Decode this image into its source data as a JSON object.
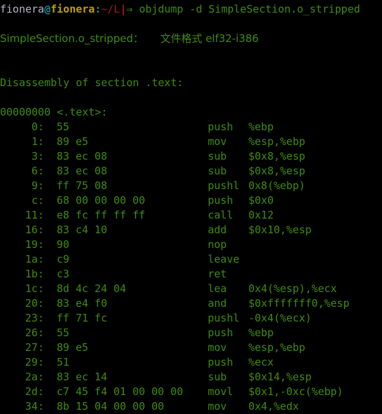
{
  "terminal": {
    "background_color": "#000000",
    "foreground_color": "#3f8c0b",
    "prompt": {
      "user": "fionera",
      "at": "@",
      "host": "fionera",
      "colon": ":",
      "path": "~/L",
      "cursor": "|",
      "arrow": "⇒",
      "command": "objdump -d SimpleSection.o_stripped",
      "user_color": "#b6b6c8",
      "at_color": "#118f94",
      "host_color": "#c0a000",
      "path_color": "#9e1b1b",
      "cursor_color": "#e01b1b",
      "arrow_color": "#4aa013"
    },
    "file_header": "SimpleSection.o_stripped：     文件格式 elf32-i386",
    "section_header": "Disassembly of section .text:",
    "symbol_line": "00000000 <.text>:",
    "disassembly": [
      {
        "addr": "0:",
        "bytes": "55",
        "mnemonic": "push",
        "operands": "%ebp"
      },
      {
        "addr": "1:",
        "bytes": "89 e5",
        "mnemonic": "mov",
        "operands": "%esp,%ebp"
      },
      {
        "addr": "3:",
        "bytes": "83 ec 08",
        "mnemonic": "sub",
        "operands": "$0x8,%esp"
      },
      {
        "addr": "6:",
        "bytes": "83 ec 08",
        "mnemonic": "sub",
        "operands": "$0x8,%esp"
      },
      {
        "addr": "9:",
        "bytes": "ff 75 08",
        "mnemonic": "pushl",
        "operands": "0x8(%ebp)"
      },
      {
        "addr": "c:",
        "bytes": "68 00 00 00 00",
        "mnemonic": "push",
        "operands": "$0x0"
      },
      {
        "addr": "11:",
        "bytes": "e8 fc ff ff ff",
        "mnemonic": "call",
        "operands": "0x12"
      },
      {
        "addr": "16:",
        "bytes": "83 c4 10",
        "mnemonic": "add",
        "operands": "$0x10,%esp"
      },
      {
        "addr": "19:",
        "bytes": "90",
        "mnemonic": "nop",
        "operands": ""
      },
      {
        "addr": "1a:",
        "bytes": "c9",
        "mnemonic": "leave",
        "operands": ""
      },
      {
        "addr": "1b:",
        "bytes": "c3",
        "mnemonic": "ret",
        "operands": ""
      },
      {
        "addr": "1c:",
        "bytes": "8d 4c 24 04",
        "mnemonic": "lea",
        "operands": "0x4(%esp),%ecx"
      },
      {
        "addr": "20:",
        "bytes": "83 e4 f0",
        "mnemonic": "and",
        "operands": "$0xfffffff0,%esp"
      },
      {
        "addr": "23:",
        "bytes": "ff 71 fc",
        "mnemonic": "pushl",
        "operands": "-0x4(%ecx)"
      },
      {
        "addr": "26:",
        "bytes": "55",
        "mnemonic": "push",
        "operands": "%ebp"
      },
      {
        "addr": "27:",
        "bytes": "89 e5",
        "mnemonic": "mov",
        "operands": "%esp,%ebp"
      },
      {
        "addr": "29:",
        "bytes": "51",
        "mnemonic": "push",
        "operands": "%ecx"
      },
      {
        "addr": "2a:",
        "bytes": "83 ec 14",
        "mnemonic": "sub",
        "operands": "$0x14,%esp"
      },
      {
        "addr": "2d:",
        "bytes": "c7 45 f4 01 00 00 00",
        "mnemonic": "movl",
        "operands": "$0x1,-0xc(%ebp)"
      },
      {
        "addr": "34:",
        "bytes": "8b 15 04 00 00 00",
        "mnemonic": "mov",
        "operands": "0x4,%edx"
      }
    ]
  }
}
